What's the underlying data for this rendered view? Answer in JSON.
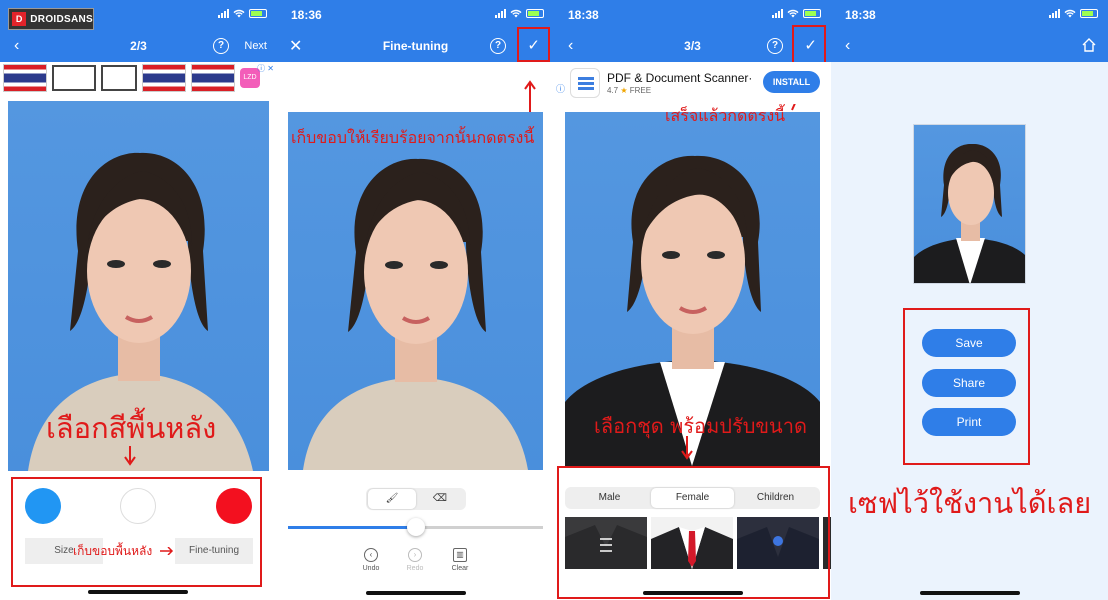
{
  "logo": {
    "mark": "D",
    "text": "DROIDSANS"
  },
  "screens": [
    {
      "nav": {
        "title": "2/3",
        "help": "?",
        "next": "Next",
        "back": "‹"
      },
      "colors": [
        "#2196f3",
        "#ffffff",
        "#f3101f"
      ],
      "tools": {
        "size": "Size",
        "fine_tuning": "Fine-tuning"
      },
      "annotations": {
        "background": "เลือกสีพื้นหลัง",
        "edge": "เก็บขอบพื้นหลัง"
      },
      "ad": {
        "close": "ⓘ ✕"
      }
    },
    {
      "status": {
        "time": "18:36"
      },
      "nav": {
        "title": "Fine-tuning",
        "help": "?",
        "close": "✕",
        "check": "✓"
      },
      "annotations": {
        "tip": "เก็บขอบให้เรียบร้อยจากนั้นกดตรงนี้"
      },
      "actions": {
        "undo": "Undo",
        "redo": "Redo",
        "clear": "Clear"
      },
      "slider": {
        "value": 0.5
      }
    },
    {
      "status": {
        "time": "18:38"
      },
      "nav": {
        "title": "3/3",
        "help": "?",
        "back": "‹",
        "check": "✓"
      },
      "ad": {
        "title": "PDF & Document Scanner·",
        "rating": "4.7",
        "price": "FREE",
        "install": "INSTALL"
      },
      "annotations": {
        "done": "เสร็จแล้วกดตรงนี้",
        "suit": "เลือกชุด พร้อมปรับขนาด"
      },
      "tabs": [
        {
          "label": "Male",
          "active": false
        },
        {
          "label": "Female",
          "active": true
        },
        {
          "label": "Children",
          "active": false
        }
      ]
    },
    {
      "status": {
        "time": "18:38"
      },
      "nav": {
        "back": "‹"
      },
      "buttons": {
        "save": "Save",
        "share": "Share",
        "print": "Print"
      },
      "annotations": {
        "caption": "เซฟไว้ใช้งานได้เลย"
      }
    }
  ],
  "colors": {
    "app_blue": "#2f7ee8",
    "annotation_red": "#e01a1a",
    "photo_bg": "#4a8fdc"
  }
}
